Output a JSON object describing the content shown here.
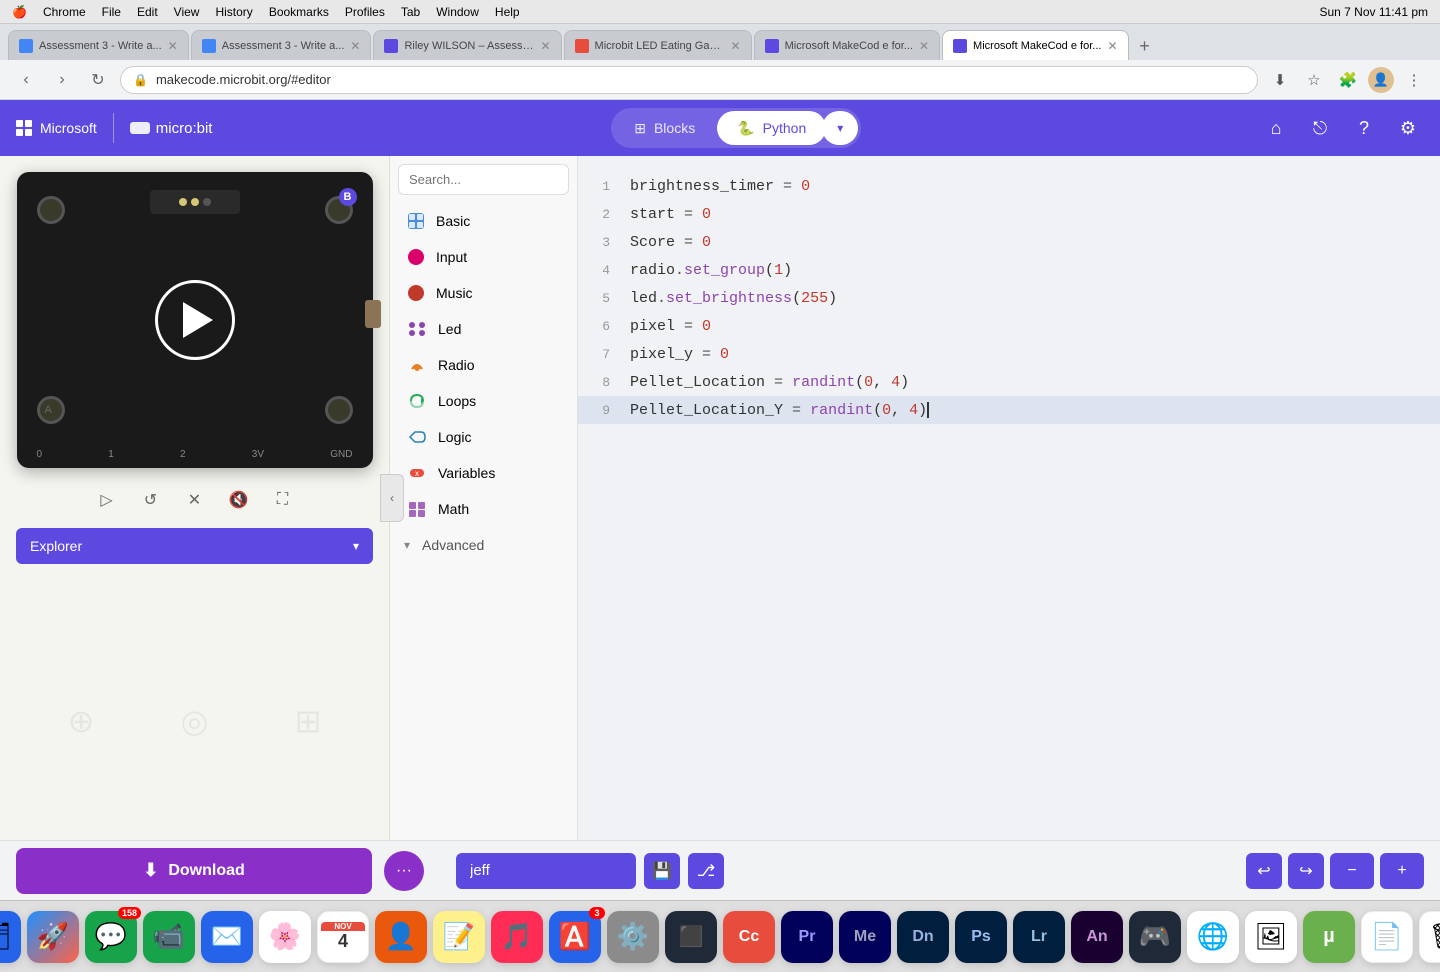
{
  "mac_menubar": {
    "apple": "🍎",
    "items": [
      "Chrome",
      "File",
      "Edit",
      "View",
      "History",
      "Bookmarks",
      "Profiles",
      "Tab",
      "Window",
      "Help"
    ],
    "time": "Sun 7 Nov  11:41 pm"
  },
  "browser": {
    "tabs": [
      {
        "id": 1,
        "label": "Assessment 3 - Write a...",
        "active": false
      },
      {
        "id": 2,
        "label": "Assessment 3 - Write a...",
        "active": false
      },
      {
        "id": 3,
        "label": "Riley WILSON – Assessm...",
        "active": false
      },
      {
        "id": 4,
        "label": "Microbit LED Eating Gam...",
        "active": false
      },
      {
        "id": 5,
        "label": "Microsoft MakeCod e for...",
        "active": false
      },
      {
        "id": 6,
        "label": "Microsoft MakeCod e for...",
        "active": true
      }
    ],
    "url": "makecode.microbit.org/#editor"
  },
  "app_header": {
    "ms_label": "Microsoft",
    "microbit_label": "micro:bit",
    "blocks_label": "Blocks",
    "python_label": "Python",
    "home_icon": "⌂",
    "share_icon": "↗",
    "help_icon": "?",
    "settings_icon": "⚙"
  },
  "blocks_panel": {
    "search_placeholder": "Search...",
    "items": [
      {
        "name": "Basic",
        "color": "#4a90d9",
        "icon": "grid"
      },
      {
        "name": "Input",
        "color": "#d9006c",
        "icon": "input"
      },
      {
        "name": "Music",
        "color": "#c0392b",
        "icon": "music"
      },
      {
        "name": "Led",
        "color": "#8e44ad",
        "icon": "led"
      },
      {
        "name": "Radio",
        "color": "#e67e22",
        "icon": "radio"
      },
      {
        "name": "Loops",
        "color": "#27ae60",
        "icon": "loops"
      },
      {
        "name": "Logic",
        "color": "#2980b9",
        "icon": "logic"
      },
      {
        "name": "Variables",
        "color": "#e74c3c",
        "icon": "variables"
      },
      {
        "name": "Math",
        "color": "#8e44ad",
        "icon": "math"
      }
    ],
    "advanced_label": "Advanced"
  },
  "code_editor": {
    "lines": [
      {
        "num": "1",
        "content": "brightness_timer = 0",
        "highlighted": false
      },
      {
        "num": "2",
        "content": "start = 0",
        "highlighted": false
      },
      {
        "num": "3",
        "content": "Score = 0",
        "highlighted": false
      },
      {
        "num": "4",
        "content": "radio.set_group(1)",
        "highlighted": false
      },
      {
        "num": "5",
        "content": "led.set_brightness(255)",
        "highlighted": false
      },
      {
        "num": "6",
        "content": "pixel = 0",
        "highlighted": false
      },
      {
        "num": "7",
        "content": "pixel_y = 0",
        "highlighted": false
      },
      {
        "num": "8",
        "content": "Pellet_Location = randint(0, 4)",
        "highlighted": false
      },
      {
        "num": "9",
        "content": "Pellet_Location_Y = randint(0, 4)",
        "highlighted": true
      }
    ]
  },
  "bottom_bar": {
    "download_label": "Download",
    "more_icon": "•••",
    "project_name": "jeff",
    "undo_icon": "↩",
    "redo_icon": "↪",
    "zoom_out_icon": "−",
    "zoom_in_icon": "+"
  },
  "explorer": {
    "label": "Explorer"
  },
  "dock": {
    "items": [
      {
        "name": "finder",
        "emoji": "🗂",
        "bg": "bg-blue",
        "badge": null
      },
      {
        "name": "launchpad",
        "emoji": "🚀",
        "bg": "bg-gray",
        "badge": null
      },
      {
        "name": "messages",
        "emoji": "💬",
        "bg": "bg-green",
        "badge": "158"
      },
      {
        "name": "facetime",
        "emoji": "📹",
        "bg": "bg-green",
        "badge": null
      },
      {
        "name": "mail",
        "emoji": "✉️",
        "bg": "bg-blue",
        "badge": null
      },
      {
        "name": "photos",
        "emoji": "🌸",
        "bg": "",
        "badge": null
      },
      {
        "name": "calendar",
        "emoji": "📅",
        "bg": "bg-red",
        "badge": "4",
        "sub": "NOV"
      },
      {
        "name": "contacts",
        "emoji": "👤",
        "bg": "bg-orange",
        "badge": null
      },
      {
        "name": "notes",
        "emoji": "📝",
        "bg": "bg-yellow",
        "badge": null
      },
      {
        "name": "music",
        "emoji": "🎵",
        "bg": "bg-red",
        "badge": null
      },
      {
        "name": "appstore",
        "emoji": "🅰️",
        "bg": "bg-blue",
        "badge": "3"
      },
      {
        "name": "systemprefs",
        "emoji": "⚙️",
        "bg": "bg-gray",
        "badge": null
      },
      {
        "name": "terminal",
        "emoji": "⬛",
        "bg": "bg-dark",
        "badge": null
      },
      {
        "name": "adobe-cc",
        "emoji": "🅰",
        "bg": "bg-red",
        "badge": null
      },
      {
        "name": "premiere",
        "emoji": "Pr",
        "bg": "bg-darkblue",
        "badge": null
      },
      {
        "name": "media-encoder",
        "emoji": "Me",
        "bg": "bg-purple",
        "badge": null
      },
      {
        "name": "dimension",
        "emoji": "Dn",
        "bg": "bg-blue",
        "badge": null
      },
      {
        "name": "photoshop",
        "emoji": "Ps",
        "bg": "bg-darkblue",
        "badge": null
      },
      {
        "name": "lightroom",
        "emoji": "Lr",
        "bg": "bg-blue",
        "badge": null
      },
      {
        "name": "animate",
        "emoji": "An",
        "bg": "bg-purple",
        "badge": null
      },
      {
        "name": "roblox",
        "emoji": "🎮",
        "bg": "bg-dark",
        "badge": null
      },
      {
        "name": "chrome",
        "emoji": "🌐",
        "bg": "bg-green",
        "badge": null
      },
      {
        "name": "preview",
        "emoji": "🖼",
        "bg": "bg-gray",
        "badge": null
      },
      {
        "name": "utorrent",
        "emoji": "µ",
        "bg": "bg-green",
        "badge": null
      },
      {
        "name": "pages",
        "emoji": "📄",
        "bg": "",
        "badge": null
      },
      {
        "name": "trash",
        "emoji": "🗑",
        "bg": "",
        "badge": null
      }
    ]
  }
}
